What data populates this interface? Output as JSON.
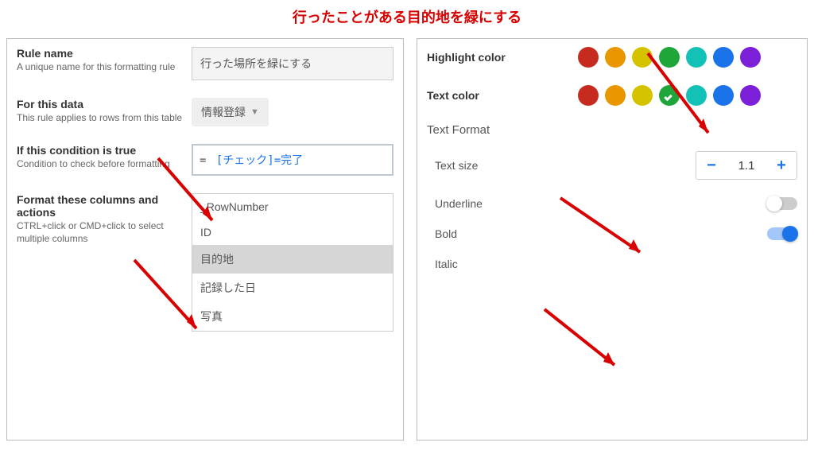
{
  "title": "行ったことがある目的地を緑にする",
  "left": {
    "ruleName": {
      "label": "Rule name",
      "desc": "A unique name for this formatting rule",
      "value": "行った場所を緑にする"
    },
    "forData": {
      "label": "For this data",
      "desc": "This rule applies to rows from this table",
      "value": "情報登録"
    },
    "condition": {
      "label": "If this condition is true",
      "desc": "Condition to check before formatting",
      "eq": "=",
      "expr": "[チェック]=完了"
    },
    "columns": {
      "label": "Format these columns and actions",
      "desc": "CTRL+click or CMD+click to select multiple columns",
      "items": [
        "_RowNumber",
        "ID",
        "目的地",
        "記録した日",
        "写真"
      ],
      "selected": "目的地"
    }
  },
  "right": {
    "highlight": {
      "label": "Highlight color"
    },
    "textcolor": {
      "label": "Text color",
      "selected": 3
    },
    "palette": [
      "#c72b1f",
      "#e99600",
      "#d6c300",
      "#1ea63a",
      "#14c1b7",
      "#1a73e8",
      "#7b1fd8"
    ],
    "sectionHeader": "Text Format",
    "textsize": {
      "label": "Text size",
      "value": "1.1"
    },
    "underline": {
      "label": "Underline",
      "on": false
    },
    "bold": {
      "label": "Bold",
      "on": true
    },
    "italic": {
      "label": "Italic"
    }
  }
}
